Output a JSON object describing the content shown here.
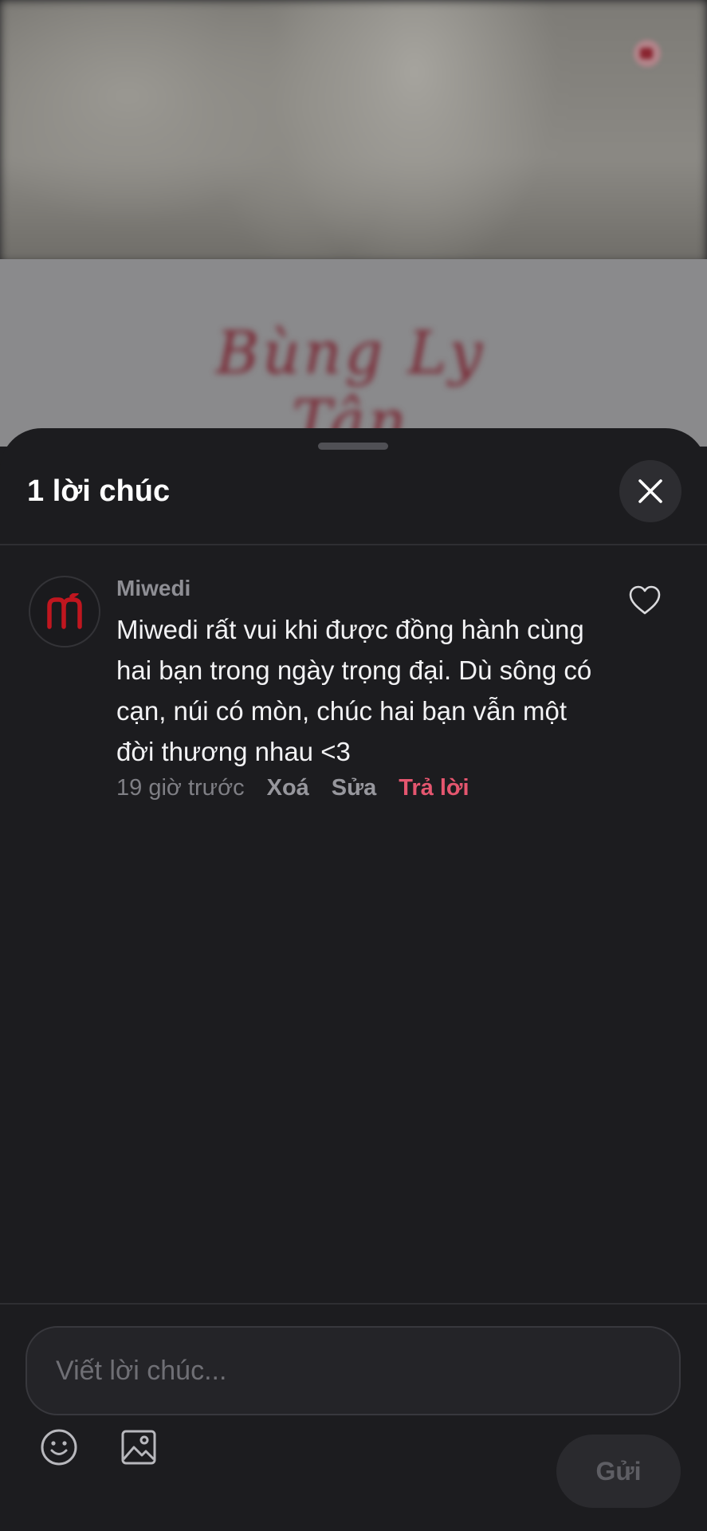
{
  "background": {
    "script_text": "Bùng Ly Tân"
  },
  "sheet": {
    "title": "1 lời chúc"
  },
  "comments": [
    {
      "author": "Miwedi",
      "avatar_text": "m",
      "text": "Miwedi rất vui khi được đồng hành cùng hai bạn trong ngày trọng đại. Dù sông có cạn, núi có mòn, chúc hai bạn vẫn một đời thương nhau <3",
      "time": "19 giờ trước",
      "delete_label": "Xoá",
      "edit_label": "Sửa",
      "reply_label": "Trả lời"
    }
  ],
  "composer": {
    "placeholder": "Viết lời chúc...",
    "send_label": "Gửi"
  },
  "colors": {
    "accent": "#e5566f",
    "sheet_bg": "#1c1c1f",
    "avatar_brand": "#c0161f"
  },
  "icons": [
    "close-icon",
    "heart-icon",
    "emoji-icon",
    "image-icon"
  ]
}
